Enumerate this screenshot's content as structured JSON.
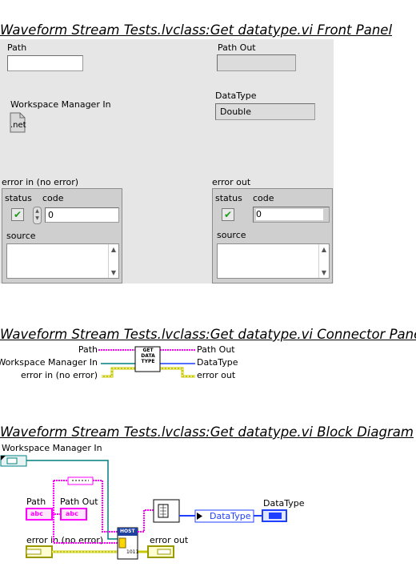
{
  "front_panel": {
    "heading": "Waveform Stream Tests.lvclass:Get datatype.vi Front Panel",
    "path_label": "Path",
    "path_out_label": "Path Out",
    "workspace_label": "Workspace Manager In",
    "net_icon_text": ".net",
    "datatype_label": "DataType",
    "datatype_value": "Double",
    "error_in_label": "error in (no error)",
    "error_out_label": "error out",
    "status_label": "status",
    "code_label": "code",
    "source_label": "source",
    "code_value": "0",
    "check_glyph": "✔"
  },
  "connector_pane": {
    "heading": "Waveform Stream Tests.lvclass:Get datatype.vi Connector Pane",
    "left_terminals": [
      "Path",
      "Workspace Manager In",
      "error in (no error)"
    ],
    "right_terminals": [
      "Path Out",
      "DataType",
      "error out"
    ],
    "icon_text": [
      "GET",
      "DATA",
      "TYPE"
    ]
  },
  "block_diagram": {
    "heading": "Waveform Stream Tests.lvclass:Get datatype.vi Block Diagram",
    "workspace_label": "Workspace Manager In",
    "path_label": "Path",
    "path_out_label": "Path Out",
    "error_in_label": "error in (no error)",
    "error_out_label": "error out",
    "datatype_label": "DataType",
    "datatype_node": "DataType",
    "abc_text": "abc",
    "host_text": "HOST",
    "bin_text": "1011"
  },
  "colors": {
    "string_wire": "#ff00ff",
    "error_wire": "#c8c800",
    "refnum_wire": "#007f7f",
    "enum_wire": "#1f3fff",
    "panel_bg": "#e6e6e6"
  }
}
